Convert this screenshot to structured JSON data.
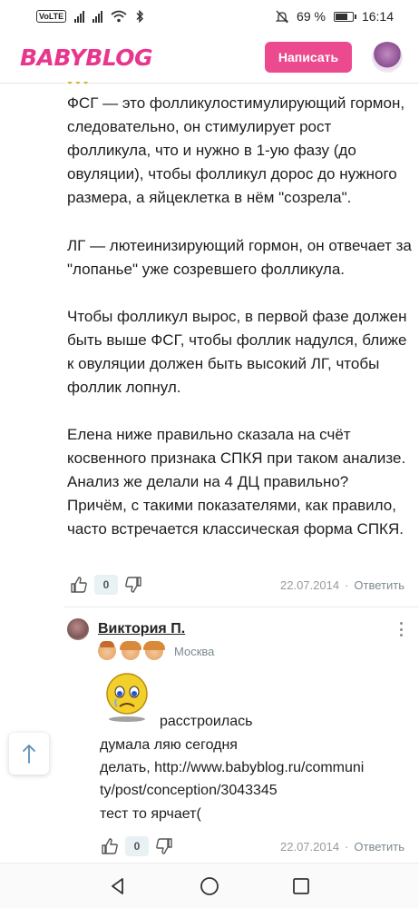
{
  "status_bar": {
    "volte": "VoLTE",
    "battery_percent": "69 %",
    "time": "16:14"
  },
  "header": {
    "logo": "BABYBLOG",
    "write_button": "Написать"
  },
  "comment": {
    "paragraphs": [
      "ФСГ — это фолликулостимулирующий гормон, следовательно, он стимулирует рост фолликула, что и нужно в 1-ую фазу (до овуляции), чтобы фолликул дорос до нужного размера, а яйцеклетка в нём \"созрела\".",
      "ЛГ — лютеинизирующий гормон, он отвечает за \"лопанье\" уже созревшего фолликула.",
      "Чтобы фолликул вырос, в первой фазе должен быть выше ФСГ, чтобы фоллик надулся, ближе к овуляции должен быть высокий ЛГ, чтобы фоллик лопнул.",
      "Елена ниже правильно сказала на счёт косвенного признака СПКЯ при таком анализе. Анализ же делали на 4 ДЦ правильно? Причём, с такими показателями, как правило, часто встречается классическая форма СПКЯ."
    ],
    "likes": "0",
    "date": "22.07.2014",
    "separator": "·",
    "reply_label": "Ответить"
  },
  "reply_comment": {
    "author": "Виктория П.",
    "city": "Москва",
    "lines": [
      "расстроилась",
      "думала ляю сегодня",
      "делать, http://www.babyblog.ru/communi",
      "ty/post/conception/3043345",
      "тест то ярчает("
    ],
    "likes": "0",
    "date": "22.07.2014",
    "separator": "·",
    "reply_label": "Ответить"
  },
  "colors": {
    "brand_pink": "#e8368f",
    "button_pink": "#ec4a8e",
    "muted": "#9a9a9a"
  },
  "icons": [
    "volte-icon",
    "signal-icon",
    "wifi-icon",
    "bluetooth-icon",
    "mute-icon",
    "battery-icon",
    "thumb-up-icon",
    "thumb-down-icon",
    "more-vert-icon",
    "sad-smiley-icon",
    "arrow-up-icon",
    "nav-back-icon",
    "nav-home-icon",
    "nav-recents-icon"
  ]
}
